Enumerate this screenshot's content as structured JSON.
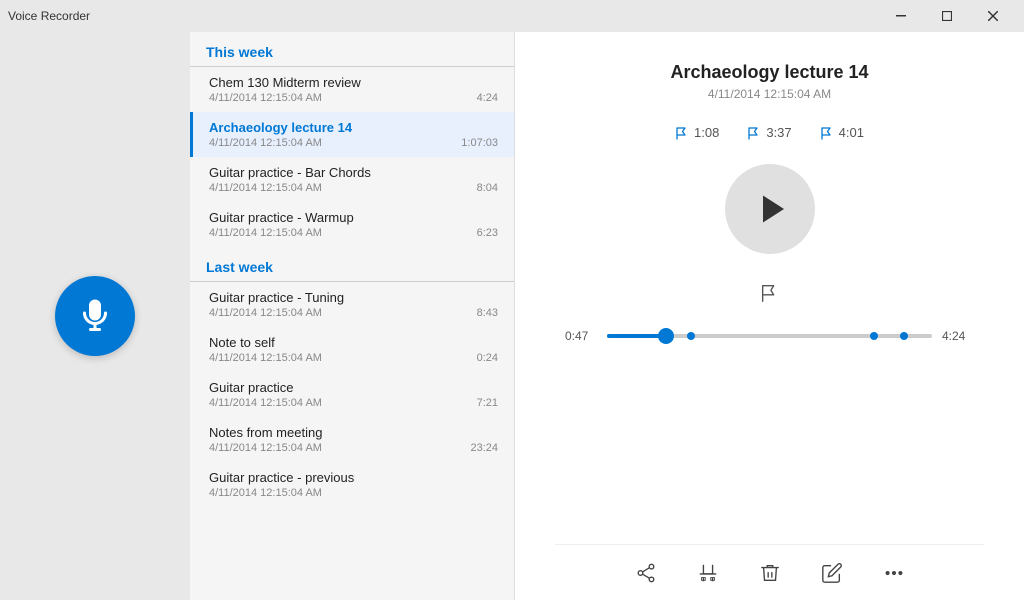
{
  "titlebar": {
    "title": "Voice Recorder",
    "minimize": "—",
    "maximize": "□",
    "close": "✕"
  },
  "sidebar": {
    "record_aria": "Record"
  },
  "sections": [
    {
      "label": "This week",
      "items": [
        {
          "title": "Chem 130 Midterm review",
          "date": "4/11/2014 12:15:04 AM",
          "duration": "4:24",
          "active": false
        },
        {
          "title": "Archaeology lecture 14",
          "date": "4/11/2014 12:15:04 AM",
          "duration": "1:07:03",
          "active": true
        },
        {
          "title": "Guitar practice - Bar Chords",
          "date": "4/11/2014 12:15:04 AM",
          "duration": "8:04",
          "active": false
        },
        {
          "title": "Guitar practice - Warmup",
          "date": "4/11/2014 12:15:04 AM",
          "duration": "6:23",
          "active": false
        }
      ]
    },
    {
      "label": "Last week",
      "items": [
        {
          "title": "Guitar practice - Tuning",
          "date": "4/11/2014 12:15:04 AM",
          "duration": "8:43",
          "active": false
        },
        {
          "title": "Note to self",
          "date": "4/11/2014 12:15:04 AM",
          "duration": "0:24",
          "active": false
        },
        {
          "title": "Guitar practice",
          "date": "4/11/2014 12:15:04 AM",
          "duration": "7:21",
          "active": false
        },
        {
          "title": "Notes from meeting",
          "date": "4/11/2014 12:15:04 AM",
          "duration": "23:24",
          "active": false
        },
        {
          "title": "Guitar practice - previous",
          "date": "4/11/2014 12:15:04 AM",
          "duration": "",
          "active": false
        }
      ]
    }
  ],
  "player": {
    "title": "Archaeology lecture 14",
    "date": "4/11/2014 12:15:04 AM",
    "markers": [
      {
        "time": "1:08"
      },
      {
        "time": "3:37"
      },
      {
        "time": "4:01"
      }
    ],
    "current_time": "0:47",
    "total_time": "4:24",
    "progress_percent": 18
  },
  "toolbar": {
    "share_label": "Share",
    "trim_label": "Trim",
    "delete_label": "Delete",
    "rename_label": "Rename",
    "more_label": "More"
  }
}
